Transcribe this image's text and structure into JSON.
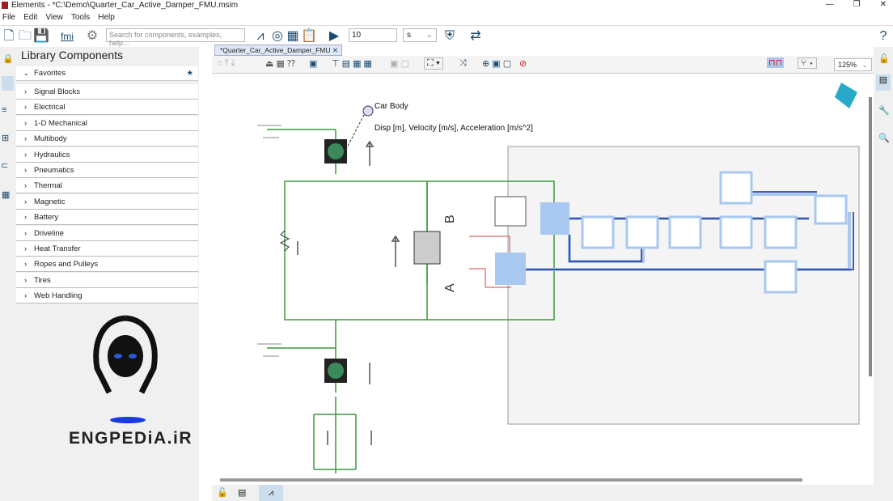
{
  "window": {
    "title": "Elements -  *C:\\Demo\\Quarter_Car_Active_Damper_FMU.msim"
  },
  "menu": [
    "File",
    "Edit",
    "View",
    "Tools",
    "Help"
  ],
  "toolbar": {
    "search_placeholder": "Search for components, examples, help...",
    "fmi_label": "fmi",
    "sim_time": "10",
    "time_unit": "s"
  },
  "library": {
    "title": "Library Components",
    "favorites": "Favorites",
    "items": [
      "Signal Blocks",
      "Electrical",
      "1-D Mechanical",
      "Multibody",
      "Hydraulics",
      "Pneumatics",
      "Thermal",
      "Magnetic",
      "Battery",
      "Driveline",
      "Heat Transfer",
      "Ropes and Pulleys",
      "Tires",
      "Web Handling"
    ]
  },
  "logo": {
    "text": "ENGPEDiA.iR"
  },
  "editor": {
    "tab": "*Quarter_Car_Active_Damper_FMU",
    "zoom": "125%"
  },
  "diagram": {
    "car_body": "Car Body",
    "sensor_label": "Disp [m], Velocity [m/s], Acceleration [m/s^2]",
    "port_b": "B",
    "port_a": "A"
  },
  "colors": {
    "accent": "#1a4a6e",
    "wire_green": "#3a9a3a",
    "signal_blue": "#1a2a8a",
    "fmu_highlight": "#a8c8f0"
  }
}
